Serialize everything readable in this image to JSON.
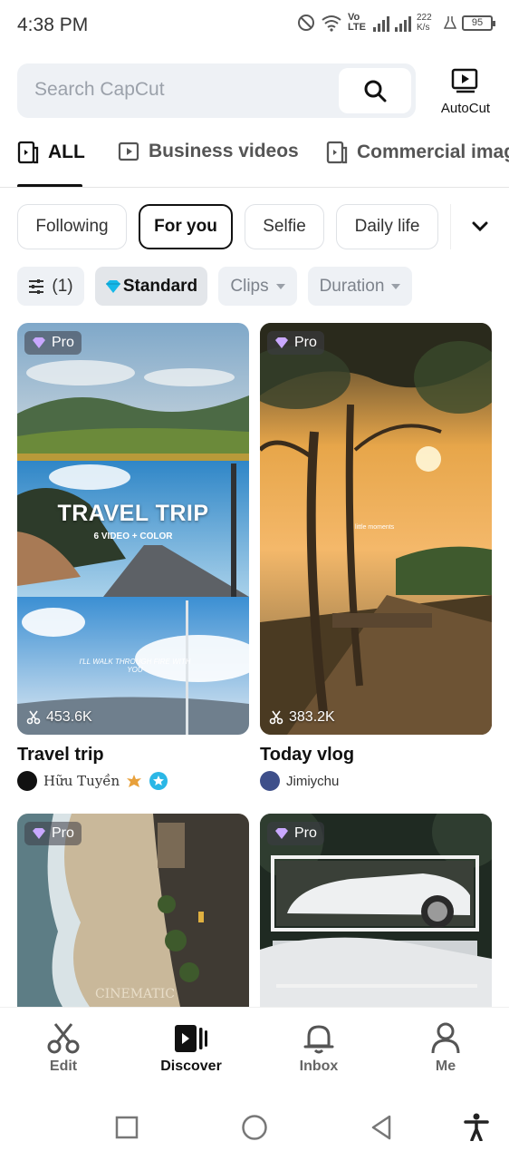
{
  "status_bar": {
    "time": "4:38 PM",
    "network": "Vo LTE",
    "speed": "222 K/s",
    "battery": "95"
  },
  "search": {
    "placeholder": "Search CapCut",
    "autocut_label": "AutoCut"
  },
  "tabs": [
    {
      "label": "ALL",
      "icon": "template-icon",
      "active": true
    },
    {
      "label": "Business videos",
      "icon": "play-icon",
      "active": false
    },
    {
      "label": "Commercial imag",
      "icon": "template-icon",
      "active": false
    }
  ],
  "chips": [
    {
      "label": "Following",
      "active": false
    },
    {
      "label": "For you",
      "active": true
    },
    {
      "label": "Selfie",
      "active": false
    },
    {
      "label": "Daily life",
      "active": false
    }
  ],
  "filters": {
    "settings_label": "(1)",
    "standard_label": "Standard",
    "clips_label": "Clips",
    "duration_label": "Duration"
  },
  "cards": [
    {
      "badge": "Pro",
      "usage": "453.6K",
      "title": "Travel trip",
      "author": "Hữu Tuyền",
      "overlay_title": "TRAVEL TRIP",
      "overlay_sub": "6 VIDEO + COLOR",
      "overlay_line": "I'LL WALK THROUGH FIRE WITH YOU"
    },
    {
      "badge": "Pro",
      "usage": "383.2K",
      "title": "Today vlog",
      "author": "Jimiychu",
      "overlay_text": "little moments"
    },
    {
      "badge": "Pro",
      "overlay_text": "CINEMATIC"
    },
    {
      "badge": "Pro"
    }
  ],
  "bottom_nav": [
    {
      "label": "Edit",
      "icon": "scissors-icon",
      "active": false
    },
    {
      "label": "Discover",
      "icon": "discover-icon",
      "active": true
    },
    {
      "label": "Inbox",
      "icon": "bell-icon",
      "active": false
    },
    {
      "label": "Me",
      "icon": "person-icon",
      "active": false
    }
  ],
  "colors": {
    "accent": "#111111",
    "chip_bg": "#eef1f5",
    "pro_gem": "#c9a8ff"
  }
}
